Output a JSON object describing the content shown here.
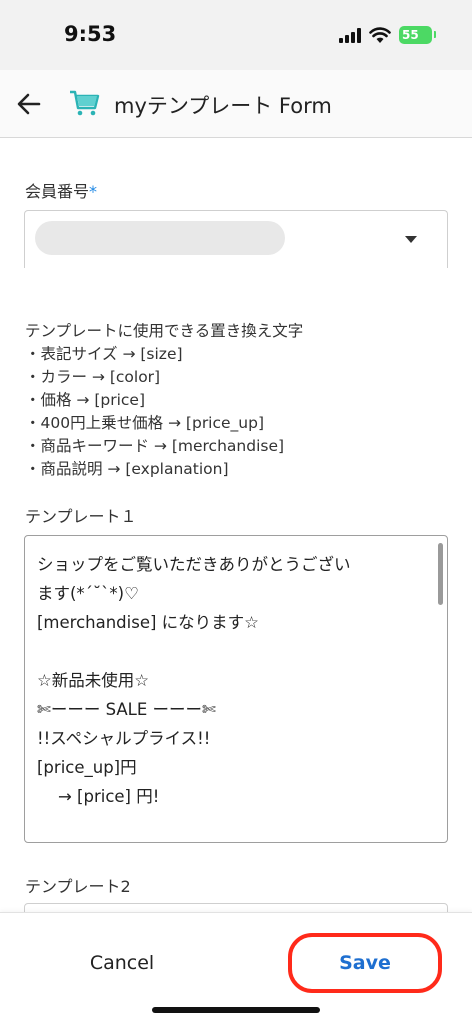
{
  "status_bar": {
    "time": "9:53",
    "battery": "55"
  },
  "app_bar": {
    "title": "myテンプレート Form"
  },
  "member_field": {
    "label": "会員番号",
    "required_mark": "*"
  },
  "help": {
    "title": "テンプレートに使用できる置き換え文字",
    "items": [
      "・表記サイズ → [size]",
      "・カラー → [color]",
      "・価格 → [price]",
      "・400円上乗せ価格 → [price_up]",
      "・商品キーワード → [merchandise]",
      "・商品説明 → [explanation]"
    ]
  },
  "template1": {
    "label": "テンプレート１",
    "value": "ショップをご覧いただきありがとうござい\nます(*´˘`*)♡\n[merchandise] になります☆\n\n☆新品未使用☆\n✄ーーー SALE ーーー✄\n!!スペシャルプライス!!\n[price_up]円\n    → [price] 円!"
  },
  "template2": {
    "label": "テンプレート2"
  },
  "actions": {
    "cancel": "Cancel",
    "save": "Save"
  },
  "colors": {
    "accent": "#1e6fd0",
    "highlight": "#ff2a1a",
    "battery": "#4cd964"
  }
}
